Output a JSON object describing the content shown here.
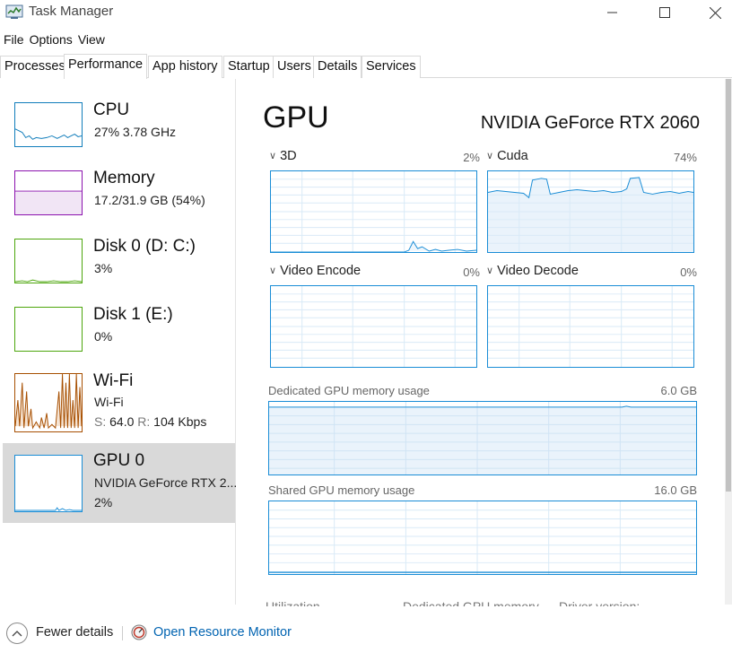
{
  "window": {
    "title": "Task Manager",
    "icon": "task-manager-icon"
  },
  "menu": [
    "File",
    "Options",
    "View"
  ],
  "tabs": [
    "Processes",
    "Performance",
    "App history",
    "Startup",
    "Users",
    "Details",
    "Services"
  ],
  "active_tab": "Performance",
  "resources": [
    {
      "title": "CPU",
      "sub1": "27%  3.78 GHz",
      "color": "#117dbb"
    },
    {
      "title": "Memory",
      "sub1": "17.2/31.9 GB (54%)",
      "color": "#8b12ae"
    },
    {
      "title": "Disk 0 (D: C:)",
      "sub1": "3%",
      "color": "#4da60c"
    },
    {
      "title": "Disk 1 (E:)",
      "sub1": "0%",
      "color": "#4da60c"
    },
    {
      "title": "Wi-Fi",
      "sub1": "Wi-Fi",
      "sub2_s_label": "S:",
      "sub2_s_value": "64.0",
      "sub2_r_label": "R:",
      "sub2_r_value": "104 Kbps",
      "color": "#a74f01"
    },
    {
      "title": "GPU 0",
      "sub1": "NVIDIA GeForce RTX 2...",
      "sub2": "2%",
      "color": "#1a8dd6"
    }
  ],
  "gpu": {
    "title": "GPU",
    "model": "NVIDIA GeForce RTX 2060",
    "engines": [
      {
        "label": "3D",
        "percent": "2%"
      },
      {
        "label": "Cuda",
        "percent": "74%"
      },
      {
        "label": "Video Encode",
        "percent": "0%"
      },
      {
        "label": "Video Decode",
        "percent": "0%"
      }
    ],
    "dedicated": {
      "label": "Dedicated GPU memory usage",
      "max": "6.0 GB"
    },
    "shared": {
      "label": "Shared GPU memory usage",
      "max": "16.0 GB"
    },
    "stats_headers": [
      "Utilization",
      "Dedicated GPU memory",
      "Driver version:"
    ]
  },
  "footer": {
    "fewer_details": "Fewer details",
    "open_resource_monitor": "Open Resource Monitor"
  }
}
